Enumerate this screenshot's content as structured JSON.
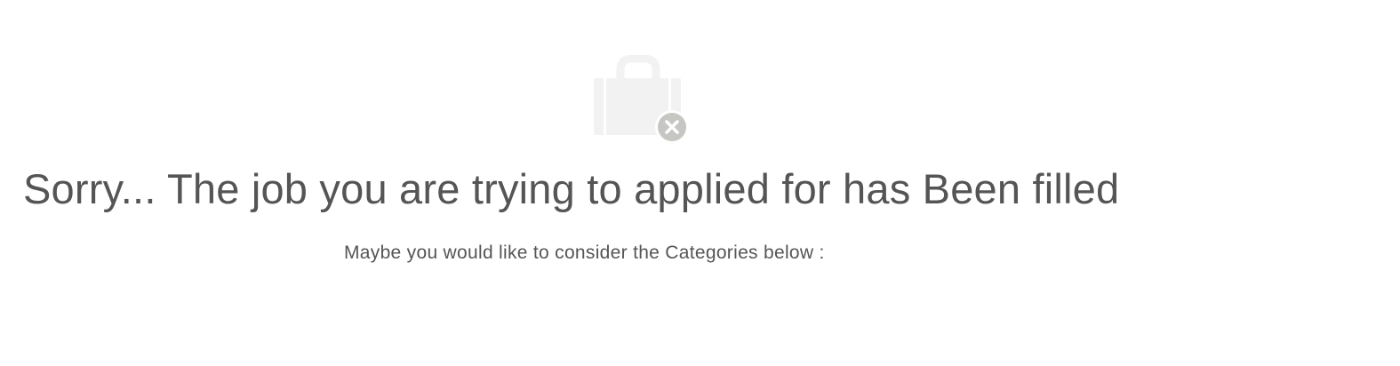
{
  "empty_state": {
    "icon": "job-filled-briefcase-icon",
    "badge_icon": "close-icon",
    "headline": "Sorry... The job you are trying to applied for has Been filled",
    "subtext": "Maybe you would like to consider the Categories below :"
  },
  "colors": {
    "text": "#555555",
    "icon_fill": "#f2f2f3",
    "badge_fill": "#c6c6c3",
    "background": "#ffffff"
  }
}
